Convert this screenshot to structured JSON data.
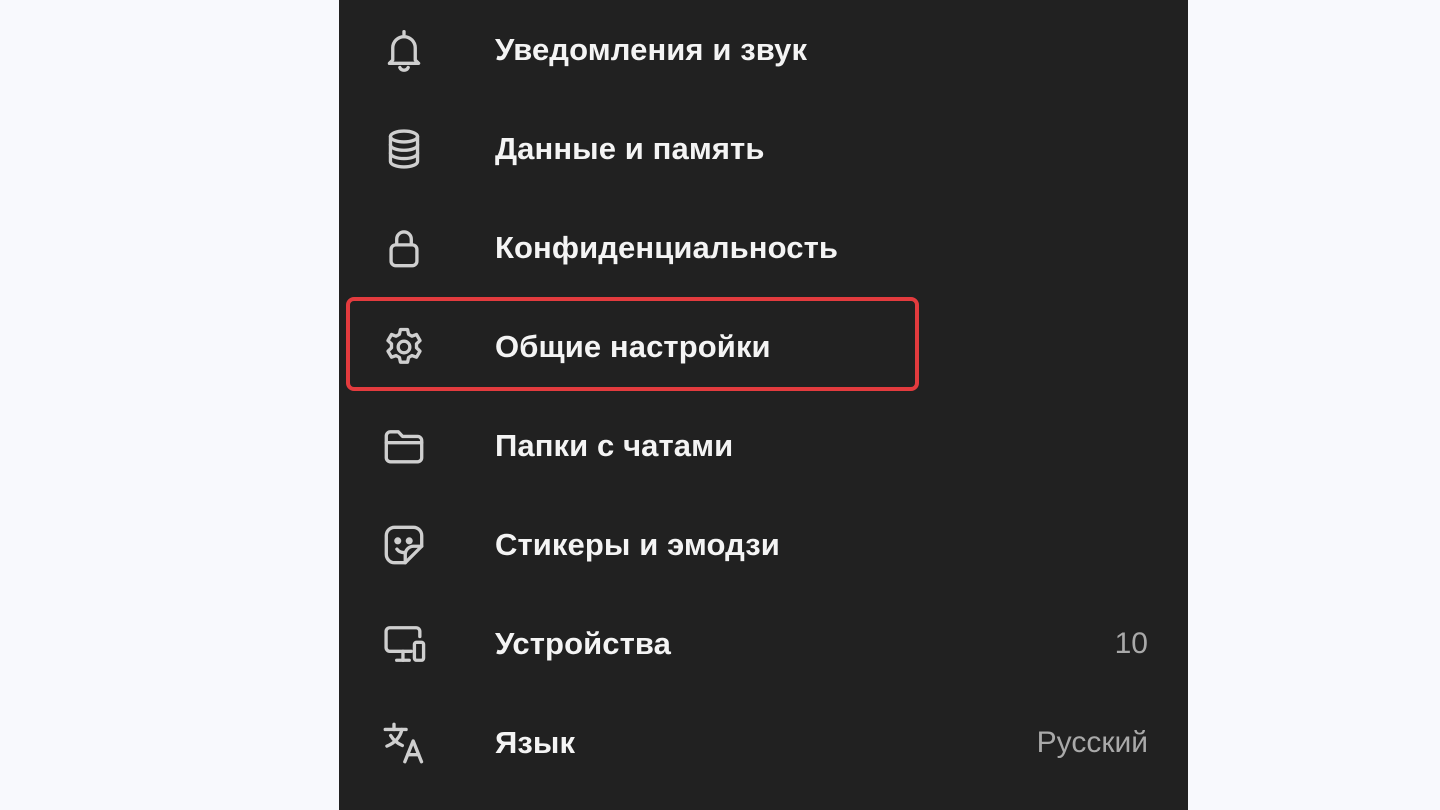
{
  "settings_menu": {
    "items": [
      {
        "label": "Уведомления и звук",
        "icon": "bell-icon",
        "value": ""
      },
      {
        "label": "Данные и память",
        "icon": "database-icon",
        "value": ""
      },
      {
        "label": "Конфиденциальность",
        "icon": "lock-icon",
        "value": ""
      },
      {
        "label": "Общие настройки",
        "icon": "gear-icon",
        "value": ""
      },
      {
        "label": "Папки с чатами",
        "icon": "folder-icon",
        "value": ""
      },
      {
        "label": "Стикеры и эмодзи",
        "icon": "sticker-icon",
        "value": ""
      },
      {
        "label": "Устройства",
        "icon": "devices-icon",
        "value": "10"
      },
      {
        "label": "Язык",
        "icon": "translate-icon",
        "value": "Русский"
      }
    ],
    "highlighted_item": "Общие настройки"
  },
  "colors": {
    "panel_background": "#212121",
    "page_background": "#f8f9fd",
    "label_text": "#f4f4f4",
    "value_text": "#a9a9a9",
    "icon_stroke": "#cfcfcf",
    "highlight_border": "#e33b3e"
  }
}
